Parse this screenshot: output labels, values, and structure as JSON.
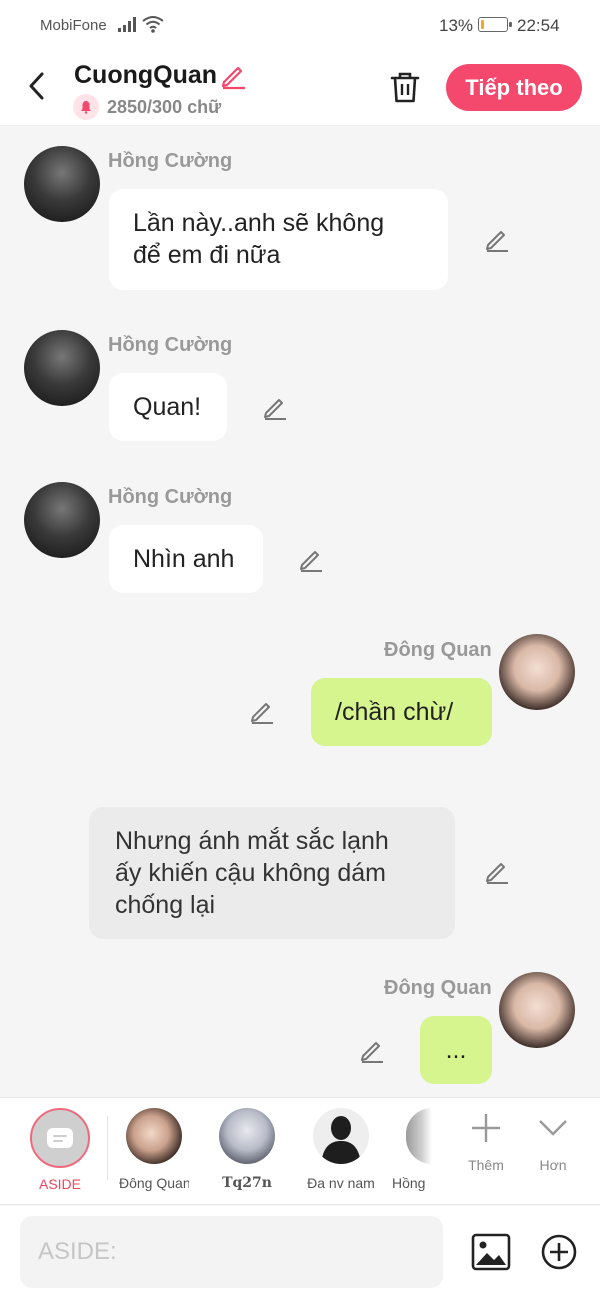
{
  "status_bar": {
    "carrier": "MobiFone",
    "battery": "13%",
    "battery_level": 0.13,
    "time": "22:54"
  },
  "header": {
    "title": "CuongQuan",
    "quota": "2850/300 chữ",
    "next_label": "Tiếp theo",
    "accent_color": "#f4486d"
  },
  "messages": [
    {
      "type": "left",
      "sender": "Hồng Cường",
      "lines": [
        "Lần này..anh sẽ không",
        "để em đi nữa"
      ]
    },
    {
      "type": "left",
      "sender": "Hồng Cường",
      "text": "Quan!"
    },
    {
      "type": "left",
      "sender": "Hồng Cường",
      "text": "Nhìn anh"
    },
    {
      "type": "right",
      "sender": "Đông Quan",
      "text": "/chần chừ/"
    },
    {
      "type": "aside",
      "lines": [
        "Nhưng ánh mắt sắc lạnh",
        "ấy khiến cậu không dám",
        "chống lại"
      ]
    },
    {
      "type": "right",
      "sender": "Đông Quan",
      "text": "..."
    }
  ],
  "char_bar": {
    "aside_label": "ASIDE",
    "characters": [
      {
        "name": "Đông Quan"
      },
      {
        "name": "Tq27n"
      },
      {
        "name": "Đa nv nam"
      },
      {
        "name": "Hồng"
      }
    ],
    "more_label": "Thêm",
    "expand_label": "Hơn"
  },
  "input": {
    "placeholder": "ASIDE:"
  },
  "colors": {
    "right_bubble": "#d6f58f",
    "left_bubble": "#ffffff",
    "aside_bubble": "#ebebeb"
  }
}
